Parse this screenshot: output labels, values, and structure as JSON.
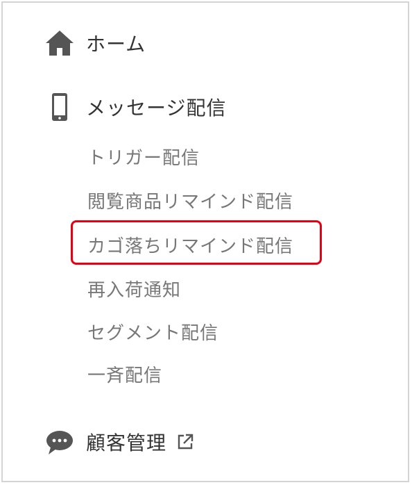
{
  "nav": {
    "home": {
      "label": "ホーム",
      "icon": "home-icon"
    },
    "messages": {
      "label": "メッセージ配信",
      "icon": "smartphone-icon",
      "items": [
        "トリガー配信",
        "閲覧商品リマインド配信",
        "カゴ落ちリマインド配信",
        "再入荷通知",
        "セグメント配信",
        "一斉配信"
      ],
      "highlighted_index": 2
    },
    "customers": {
      "label": "顧客管理",
      "icon": "chat-bubble-icon",
      "external_icon": "external-link-icon"
    }
  },
  "colors": {
    "highlight": "#e60012",
    "icon": "#555555",
    "primary_text": "#333333",
    "secondary_text": "#777777"
  }
}
